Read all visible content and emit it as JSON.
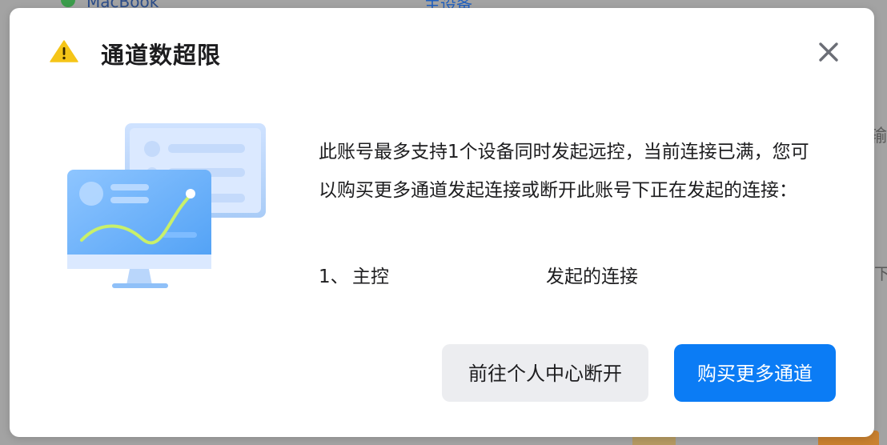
{
  "background": {
    "device_name": "MacBook",
    "main_device_label": "主设备",
    "side_char_1": "输",
    "side_char_2": "下"
  },
  "dialog": {
    "title": "通道数超限",
    "message": "此账号最多支持1个设备同时发起远控，当前连接已满，您可以购买更多通道发起连接或断开此账号下正在发起的连接：",
    "connections": [
      {
        "index": "1、",
        "name": "主控",
        "description": "发起的连接"
      }
    ],
    "secondary_button": "前往个人中心断开",
    "primary_button": "购买更多通道"
  },
  "colors": {
    "primary": "#0b7cf5",
    "warning": "#f5c518",
    "secondary_button_bg": "#ecedf0"
  },
  "icons": {
    "warning": "warning-triangle-icon",
    "close": "close-icon",
    "illustration": "monitor-illustration"
  }
}
